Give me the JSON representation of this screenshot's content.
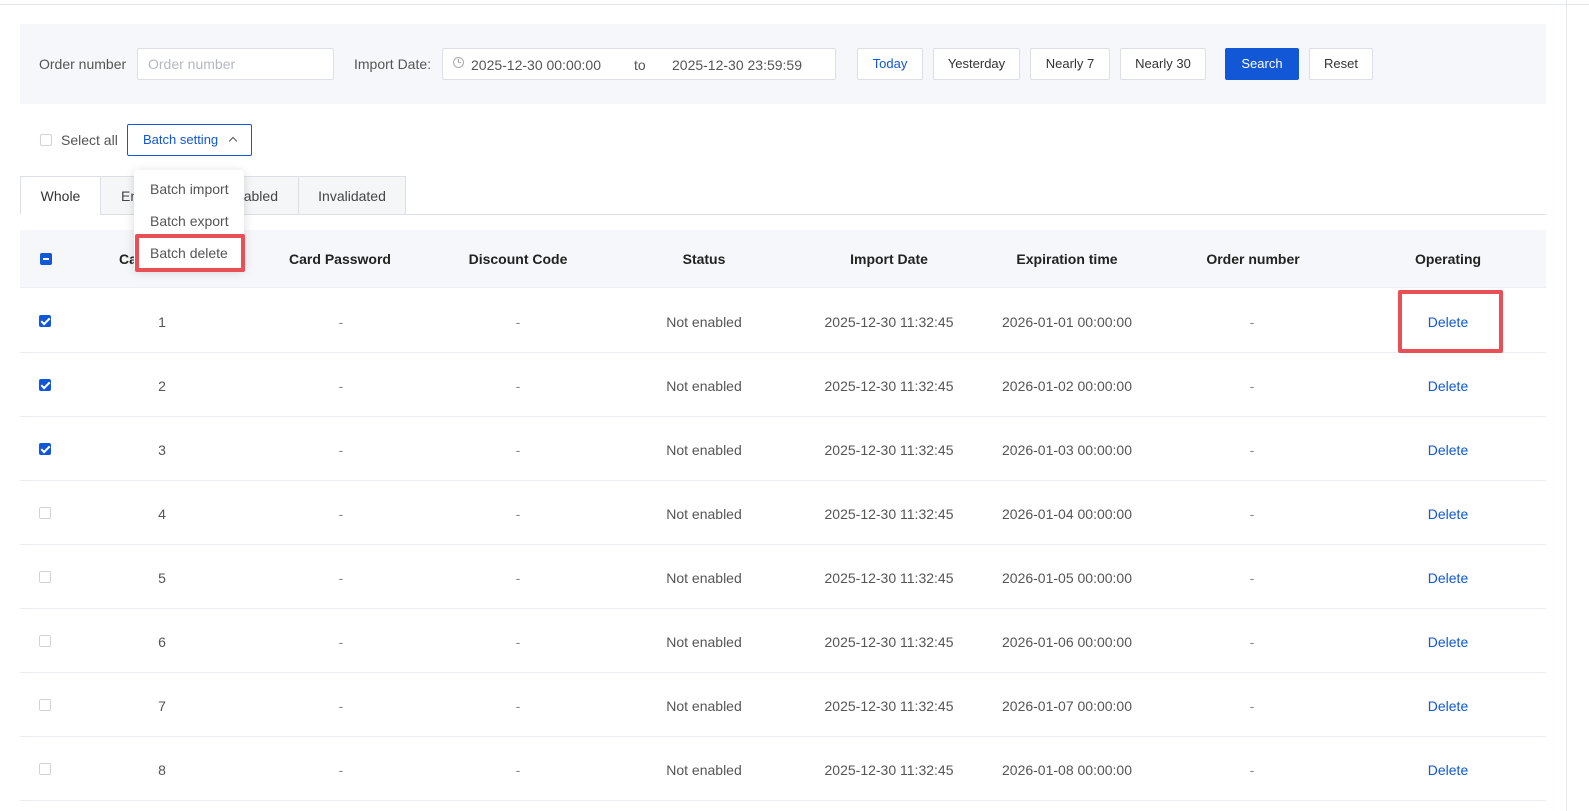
{
  "filters": {
    "order_label": "Order number",
    "order_placeholder": "Order number",
    "order_value": "",
    "import_date_label": "Import Date:",
    "date_start": "2025-12-30 00:00:00",
    "date_sep": "to",
    "date_end": "2025-12-30 23:59:59",
    "quick_buttons": [
      "Today",
      "Yesterday",
      "Nearly 7",
      "Nearly 30"
    ],
    "search_label": "Search",
    "reset_label": "Reset"
  },
  "toolbar": {
    "select_all_label": "Select all",
    "batch_label": "Batch setting"
  },
  "dropdown": {
    "items": [
      "Batch import",
      "Batch export",
      "Batch delete"
    ]
  },
  "tabs": [
    "Whole",
    "En",
    "abled",
    "Invalidated"
  ],
  "table": {
    "headers": [
      "Ca",
      "Card Password",
      "Discount Code",
      "Status",
      "Import Date",
      "Expiration time",
      "Order number",
      "Operating"
    ],
    "rows": [
      {
        "card": "1",
        "password": "-",
        "discount": "-",
        "status": "Not enabled",
        "import_date": "2025-12-30 11:32:45",
        "expiration": "2026-01-01 00:00:00",
        "order": "-",
        "action": "Delete",
        "checked": true
      },
      {
        "card": "2",
        "password": "-",
        "discount": "-",
        "status": "Not enabled",
        "import_date": "2025-12-30 11:32:45",
        "expiration": "2026-01-02 00:00:00",
        "order": "-",
        "action": "Delete",
        "checked": true
      },
      {
        "card": "3",
        "password": "-",
        "discount": "-",
        "status": "Not enabled",
        "import_date": "2025-12-30 11:32:45",
        "expiration": "2026-01-03 00:00:00",
        "order": "-",
        "action": "Delete",
        "checked": true
      },
      {
        "card": "4",
        "password": "-",
        "discount": "-",
        "status": "Not enabled",
        "import_date": "2025-12-30 11:32:45",
        "expiration": "2026-01-04 00:00:00",
        "order": "-",
        "action": "Delete",
        "checked": false
      },
      {
        "card": "5",
        "password": "-",
        "discount": "-",
        "status": "Not enabled",
        "import_date": "2025-12-30 11:32:45",
        "expiration": "2026-01-05 00:00:00",
        "order": "-",
        "action": "Delete",
        "checked": false
      },
      {
        "card": "6",
        "password": "-",
        "discount": "-",
        "status": "Not enabled",
        "import_date": "2025-12-30 11:32:45",
        "expiration": "2026-01-06 00:00:00",
        "order": "-",
        "action": "Delete",
        "checked": false
      },
      {
        "card": "7",
        "password": "-",
        "discount": "-",
        "status": "Not enabled",
        "import_date": "2025-12-30 11:32:45",
        "expiration": "2026-01-07 00:00:00",
        "order": "-",
        "action": "Delete",
        "checked": false
      },
      {
        "card": "8",
        "password": "-",
        "discount": "-",
        "status": "Not enabled",
        "import_date": "2025-12-30 11:32:45",
        "expiration": "2026-01-08 00:00:00",
        "order": "-",
        "action": "Delete",
        "checked": false
      }
    ]
  },
  "colors": {
    "accent": "#1157d6",
    "highlight": "#e94f57"
  },
  "icons": [
    "clock-icon",
    "chevron-up-icon",
    "checkbox-icon"
  ]
}
